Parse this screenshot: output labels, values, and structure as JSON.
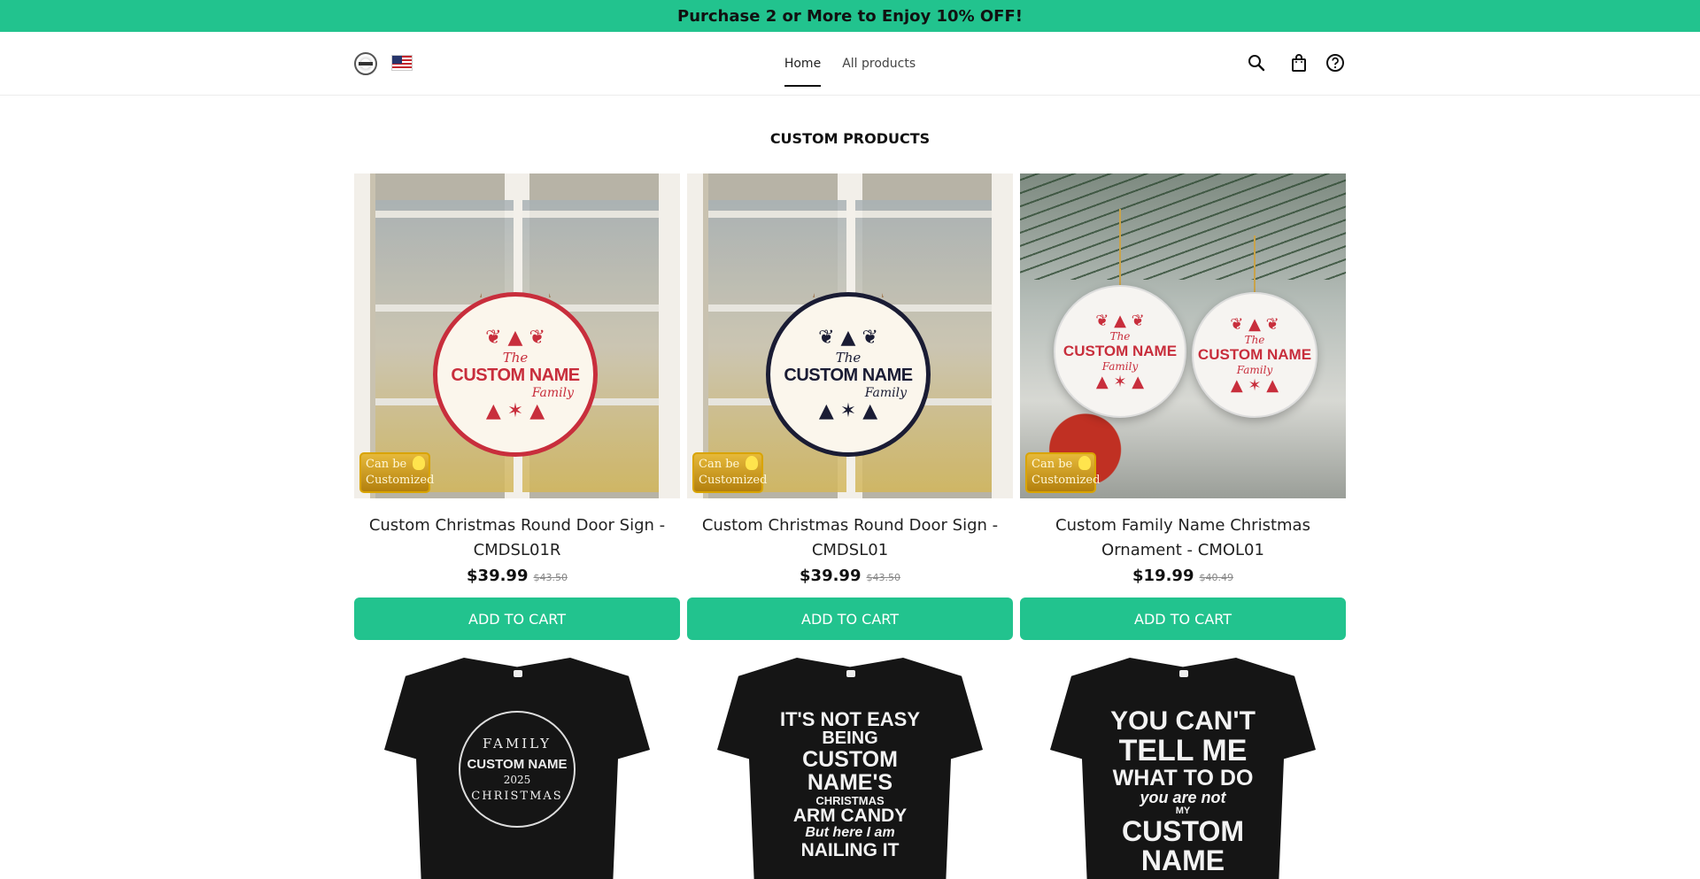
{
  "announcement": {
    "text": "Purchase 2 or More to Enjoy 10% OFF!"
  },
  "header": {
    "logo_alt": "logo",
    "nav": [
      {
        "label": "Home",
        "active": true
      },
      {
        "label": " All products",
        "active": false
      }
    ],
    "icons": [
      "search-icon",
      "shopping-bag-icon",
      "help-icon"
    ]
  },
  "section": {
    "title": "CUSTOM PRODUCTS"
  },
  "badge": {
    "line1": "Can be",
    "line2": "Customized"
  },
  "products": [
    {
      "title": "Custom Christmas Round Door Sign - CMDSL01R",
      "price": "$39.99",
      "compare_price": "$43.50",
      "button": "ADD TO CART",
      "art": {
        "the": "The",
        "name": "CUSTOM NAME",
        "family": "Family"
      }
    },
    {
      "title": "Custom Christmas Round Door Sign - CMDSL01",
      "price": "$39.99",
      "compare_price": "$43.50",
      "button": "ADD TO CART",
      "art": {
        "the": "The",
        "name": "CUSTOM NAME",
        "family": "Family"
      }
    },
    {
      "title": "Custom Family Name Christmas Ornament - CMOL01",
      "price": "$19.99",
      "compare_price": "$40.49",
      "button": "ADD TO CART",
      "art": {
        "the": "The",
        "name": "CUSTOM NAME",
        "family": "Family"
      }
    },
    {
      "art": {
        "top": "FAMILY",
        "name": "CUSTOM NAME",
        "year": "2025",
        "bottom": "CHRISTMAS"
      }
    },
    {
      "art": {
        "l1": "IT'S NOT EASY",
        "l2": "BEING",
        "l3": "CUSTOM NAME'S",
        "l4": "CHRISTMAS",
        "l5": "ARM CANDY",
        "l6": "But here I am",
        "l7": "NAILING IT"
      }
    },
    {
      "art": {
        "l1": "YOU CAN'T",
        "l2": "TELL ME",
        "l3": "WHAT TO DO",
        "l4": "you are not",
        "l5": "MY",
        "l6": "CUSTOM NAME"
      }
    }
  ],
  "colors": {
    "accent": "#22c38e",
    "sign_red": "#c82e3c",
    "sign_navy": "#1a1c34"
  }
}
